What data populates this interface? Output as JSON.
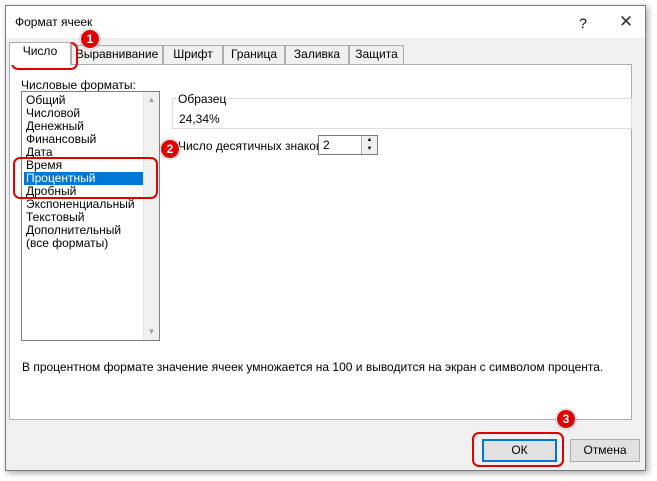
{
  "dialog": {
    "title": "Формат ячеек",
    "help": "?",
    "close": "✕"
  },
  "tabs": [
    "Число",
    "Выравнивание",
    "Шрифт",
    "Граница",
    "Заливка",
    "Защита"
  ],
  "active_tab": "Число",
  "categories": {
    "label": "Числовые форматы:",
    "items": [
      "Общий",
      "Числовой",
      "Денежный",
      "Финансовый",
      "Дата",
      "Время",
      "Процентный",
      "Дробный",
      "Экспоненциальный",
      "Текстовый",
      "Дополнительный",
      "(все форматы)"
    ],
    "selected": "Процентный"
  },
  "sample": {
    "label": "Образец",
    "value": "24,34%"
  },
  "decimals": {
    "label": "Число десятичных знаков:",
    "value": "2"
  },
  "description": "В процентном формате значение ячеек умножается на 100 и выводится на экран с символом процента.",
  "buttons": {
    "ok": "ОК",
    "cancel": "Отмена"
  },
  "annotations": [
    "1",
    "2",
    "3"
  ],
  "colors": {
    "highlight": "#e00000",
    "selection": "#0078d7"
  }
}
